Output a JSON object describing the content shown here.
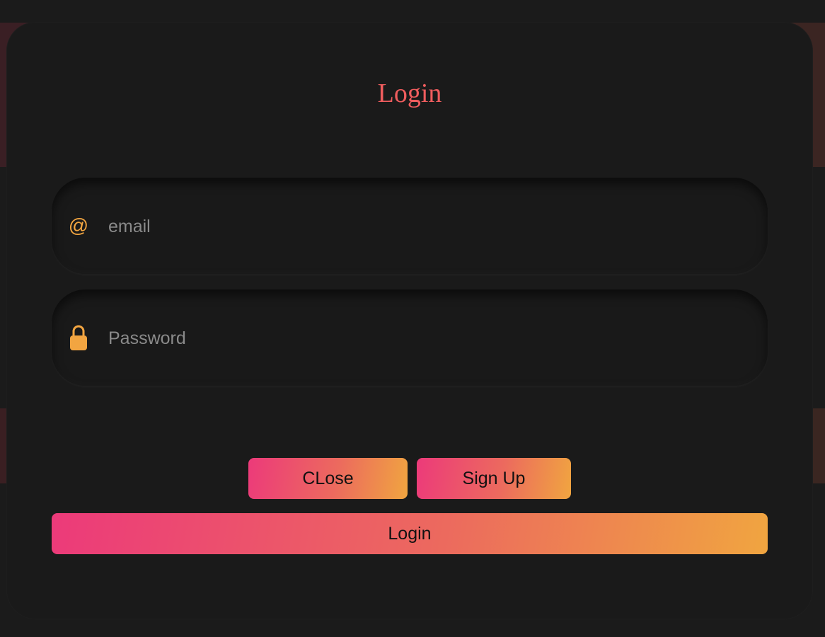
{
  "modal": {
    "title": "Login"
  },
  "form": {
    "email": {
      "icon": "at-sign-icon",
      "placeholder": "email",
      "value": ""
    },
    "password": {
      "icon": "lock-icon",
      "placeholder": "Password",
      "value": ""
    }
  },
  "buttons": {
    "close_label": "CLose",
    "signup_label": "Sign Up",
    "login_label": "Login"
  },
  "colors": {
    "accent_title": "#f05d5e",
    "icon": "#f2a541",
    "gradient_start": "#ec3a7a",
    "gradient_end": "#f0a540",
    "modal_bg": "#1a1a1a"
  }
}
